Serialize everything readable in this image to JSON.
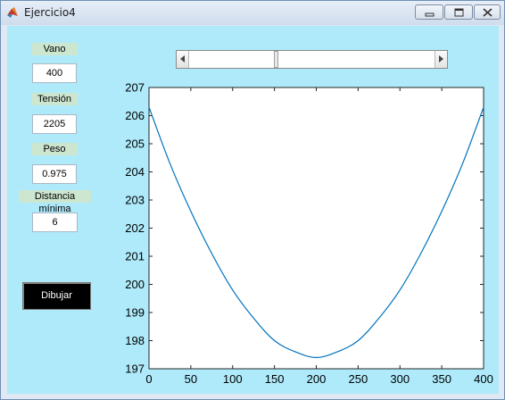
{
  "window": {
    "title": "Ejercicio4",
    "icons": [
      "matlab-icon",
      "minimize-icon",
      "maximize-icon",
      "close-icon"
    ]
  },
  "inputs": {
    "vano_label": "Vano",
    "vano_value": "400",
    "tension_label": "Tensión",
    "tension_value": "2205",
    "peso_label": "Peso",
    "peso_value": "0.975",
    "distancia_label": "Distancia mínima",
    "distancia_value": "6"
  },
  "button": {
    "dibujar_label": "Dibujar"
  },
  "slider": {
    "position": 0.35
  },
  "colors": {
    "background": "#aeeafa",
    "line": "#0072bd",
    "label_bg": "#cde6d0"
  },
  "chart_data": {
    "type": "line",
    "title": "",
    "xlabel": "",
    "ylabel": "",
    "xlim": [
      0,
      400
    ],
    "ylim": [
      197,
      207
    ],
    "xticks": [
      0,
      50,
      100,
      150,
      200,
      250,
      300,
      350,
      400
    ],
    "yticks": [
      197,
      198,
      199,
      200,
      201,
      202,
      203,
      204,
      205,
      206,
      207
    ],
    "grid": false,
    "series": [
      {
        "x": [
          0,
          25,
          50,
          75,
          100,
          125,
          150,
          175,
          200,
          225,
          250,
          275,
          300,
          325,
          350,
          375,
          400
        ],
        "y": [
          206.3,
          204.3,
          202.6,
          201.1,
          199.8,
          198.8,
          198.0,
          197.6,
          197.4,
          197.6,
          198.0,
          198.8,
          199.8,
          201.1,
          202.6,
          204.3,
          206.3
        ]
      }
    ]
  }
}
